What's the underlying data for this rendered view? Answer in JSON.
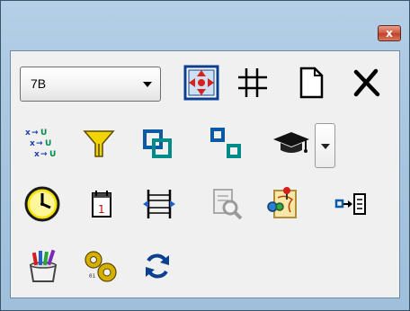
{
  "window": {
    "close_glyph": "x"
  },
  "toolbar": {
    "level_select": {
      "value": "7B"
    },
    "icons": [
      "move-icon",
      "grid-icon",
      "new-document-icon",
      "delete-icon",
      "sort-variables-icon",
      "filter-icon",
      "group-icon",
      "ungroup-icon",
      "graduation-cap-icon",
      "clock-icon",
      "calendar-icon",
      "fit-width-icon",
      "zoom-document-icon",
      "map-pin-icon",
      "export-icon",
      "edit-paint-icon",
      "settings-gears-icon",
      "refresh-icon"
    ]
  },
  "colors": {
    "title_gradient": "#a7c5df",
    "content_bg": "#f0f0f0",
    "close_red": "#c2402a",
    "icon_blue": "#0b5aa3",
    "icon_teal": "#008b8b",
    "icon_yellow": "#f2d400"
  }
}
